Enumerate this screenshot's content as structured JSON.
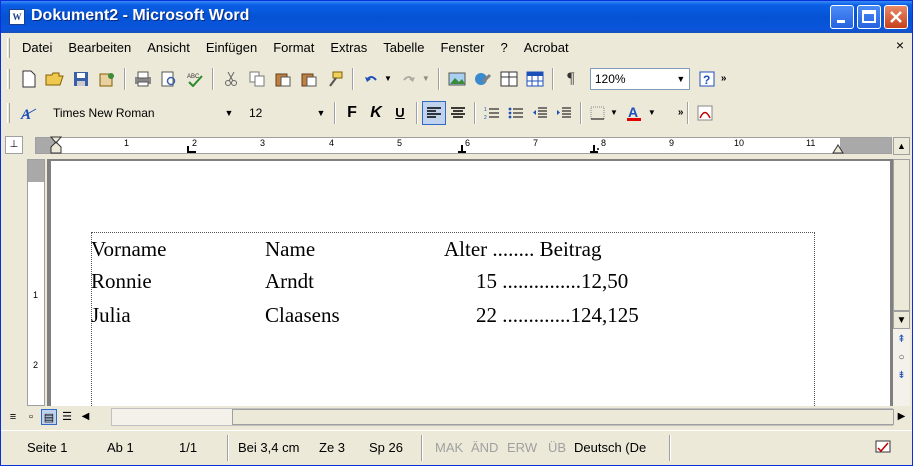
{
  "window": {
    "title": "Dokument2 - Microsoft Word",
    "app_icon_text": "W"
  },
  "menu": {
    "items": [
      "Datei",
      "Bearbeiten",
      "Ansicht",
      "Einfügen",
      "Format",
      "Extras",
      "Tabelle",
      "Fenster",
      "?",
      "Acrobat"
    ],
    "close_glyph": "×"
  },
  "toolbar_standard": {
    "zoom": "120%"
  },
  "toolbar_format": {
    "font_name": "Times New Roman",
    "font_size": "12",
    "bold": "F",
    "italic": "K",
    "underline": "U"
  },
  "ruler": {
    "ticks": [
      "1",
      "2",
      "3",
      "4",
      "5",
      "6",
      "7",
      "8",
      "9",
      "10",
      "11"
    ],
    "vertical_marks": [
      "1",
      "2"
    ]
  },
  "document": {
    "lines": [
      {
        "c1": "Vorname",
        "c2": "Name",
        "c3": "Alter ........ Beitrag"
      },
      {
        "c1": "Ronnie",
        "c2": "Arndt",
        "c3": "15 ...............12,50"
      },
      {
        "c1": "Julia",
        "c2": "Claasens",
        "c3": "22 .............124,125"
      }
    ]
  },
  "status": {
    "page": "Seite 1",
    "section": "Ab 1",
    "pages": "1/1",
    "position": "Bei 3,4 cm",
    "line": "Ze 3",
    "column": "Sp 26",
    "mak": "MAK",
    "aend": "ÄND",
    "erw": "ERW",
    "ueb": "ÜB",
    "language": "Deutsch (De"
  }
}
